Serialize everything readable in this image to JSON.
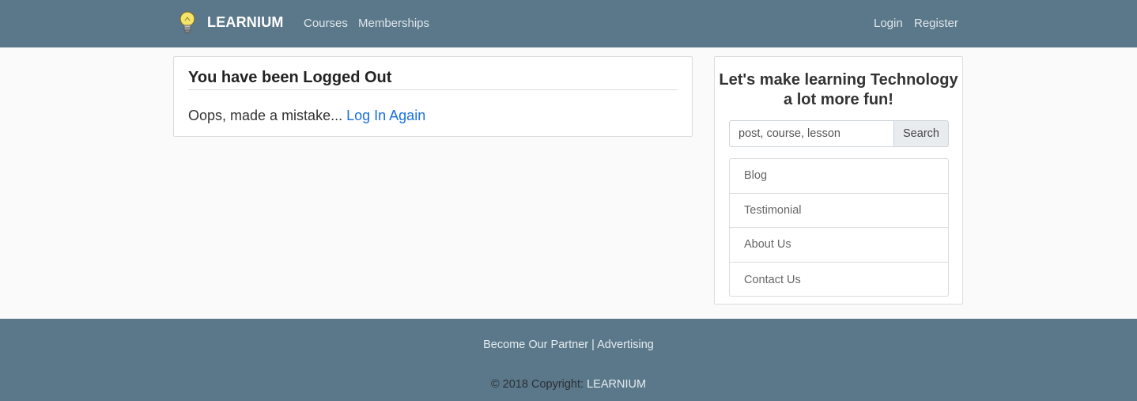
{
  "navbar": {
    "brand": "LEARNIUM",
    "brand_icon": "lightbulb-icon",
    "links": {
      "courses": "Courses",
      "memberships": "Memberships",
      "login": "Login",
      "register": "Register"
    },
    "background_color": "#5b788b"
  },
  "main": {
    "title": "You have been Logged Out",
    "message": "Oops, made a mistake...",
    "link_text": "Log In Again",
    "link_color": "#1a6fe0"
  },
  "sidebar": {
    "tagline": "Let's make learning Technology a lot more fun!",
    "search": {
      "placeholder": "post, course, lesson",
      "value": "",
      "button_label": "Search"
    },
    "menu": [
      {
        "label": "Blog"
      },
      {
        "label": "Testimonial"
      },
      {
        "label": "About Us"
      },
      {
        "label": "Contact Us"
      }
    ]
  },
  "footer": {
    "partner": "Become Our Partner",
    "separator": "|",
    "advertising": "Advertising",
    "copyright_prefix": "© 2018 Copyright:",
    "copyright_brand": "LEARNIUM"
  }
}
